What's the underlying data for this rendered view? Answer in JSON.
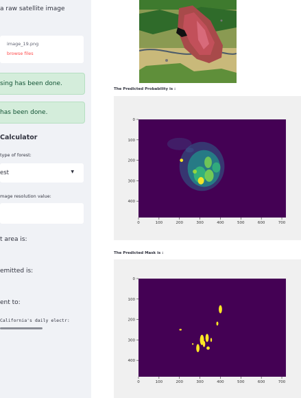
{
  "sidebar": {
    "upload_prompt": "a raw satellite image",
    "uploaded_file": "image_19.png",
    "browse_label": "browse files",
    "alerts": [
      "sing has been done.",
      "has been done."
    ],
    "calculator_title": "Calculator",
    "forest_type_label": "type of forest:",
    "forest_type_value": "est",
    "resolution_label": "mage resolution value:",
    "resolution_value": "",
    "area_label": "t area is:",
    "emitted_label": "emitted is:",
    "equivalent_label": "ent to:",
    "equivalent_value": "California's  daily electr:"
  },
  "main": {
    "probability_label": "The Predicted Probability is :",
    "mask_label": "The Predicted Mask is :"
  },
  "colors": {
    "success_bg": "#d4eddb",
    "success_text": "#0f5132",
    "link": "#ff4b4b",
    "viridis_dark": "#440154",
    "viridis_yellow": "#fde725",
    "viridis_green": "#35b779",
    "viridis_teal": "#21918c"
  },
  "chart_data": [
    {
      "type": "heatmap",
      "title": "",
      "colormap": "viridis",
      "x_ticks": [
        "0",
        "100",
        "200",
        "300",
        "400",
        "500",
        "600",
        "700"
      ],
      "y_ticks": [
        "0",
        "100",
        "200",
        "300",
        "400"
      ],
      "xlim": [
        0,
        720
      ],
      "ylim": [
        480,
        0
      ]
    },
    {
      "type": "heatmap",
      "title": "",
      "colormap": "viridis",
      "x_ticks": [
        "0",
        "100",
        "200",
        "300",
        "400",
        "500",
        "600",
        "700"
      ],
      "y_ticks": [
        "0",
        "100",
        "200",
        "300",
        "400"
      ],
      "xlim": [
        0,
        720
      ],
      "ylim": [
        480,
        0
      ]
    }
  ]
}
